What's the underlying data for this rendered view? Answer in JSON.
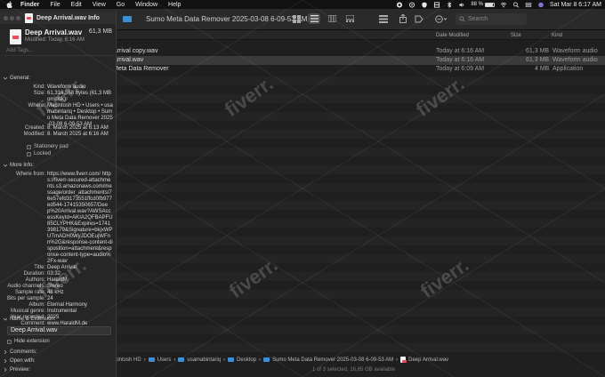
{
  "menubar": {
    "items": [
      "Finder",
      "File",
      "Edit",
      "View",
      "Go",
      "Window",
      "Help"
    ],
    "battery_percent": "88 %",
    "battery_level": 0.88,
    "datetime": "Sat Mar 8  6:17 AM"
  },
  "window": {
    "title": "Sumo Meta Data Remover 2025-03-08 6-09-53 AM",
    "search_placeholder": "Search"
  },
  "columns": {
    "date": "Date Modified",
    "size": "Size",
    "kind": "Kind"
  },
  "files": [
    {
      "name": "Arrival copy.wav",
      "date": "Today at 6:16 AM",
      "size": "61,3 MB",
      "kind": "Waveform audio"
    },
    {
      "name": "Arrival.wav",
      "date": "Today at 6:16 AM",
      "size": "61,3 MB",
      "kind": "Waveform audio"
    },
    {
      "name": "Meta Data Remover",
      "date": "Today at 6:09 AM",
      "size": "4 MB",
      "kind": "Application"
    }
  ],
  "path": [
    "Macintosh HD",
    "Users",
    "usamabintariq",
    "Desktop",
    "Sumo Meta Data Remover 2025-03-08 6-09-53 AM",
    "Deep Arrival.wav"
  ],
  "status": "1 of 3 selected, 16,85 GB available",
  "info": {
    "window_title": "Deep Arrival.wav Info",
    "file_name": "Deep Arrival.wav",
    "file_size": "61,3 MB",
    "modified_line": "Modified: Today, 6:16 AM",
    "tags_placeholder": "Add Tags...",
    "general_label": "General:",
    "general": [
      {
        "k": "Kind:",
        "v": "Waveform audio"
      },
      {
        "k": "Size:",
        "v": "61,318,558 bytes (61,3 MB on disk)"
      },
      {
        "k": "Where:",
        "v": "Macintosh HD • Users • usamabintariq • Desktop • Sumo Meta Data Remover 2025-03-08 6-09-53 AM"
      },
      {
        "k": "Created:",
        "v": "8. March 2025 at 6:13 AM"
      },
      {
        "k": "Modified:",
        "v": "8. March 2025 at 6:16 AM"
      }
    ],
    "stationery": "Stationery pad",
    "locked": "Locked",
    "more_info_label": "More Info:",
    "more_info": [
      {
        "k": "Where from:",
        "v": "https://www.fiverr.com/ https://fiverr-secured-attachments.s3.amazonaws.com/message/order_attachments/76e57efd3173551ffcd0fb977ed544-17415350657/Deep%20Arrival.wav?AWSAccessKeyId=AKIA2QFBAPFU85CLYPHK&Expires=1741398179&Signature=bkjxWPUTmADH0WyJDOEujWFnn%2G&response-content-disposition=attachment&response-content-type=audio%2Fx-wav"
      },
      {
        "k": "Title:",
        "v": "Deep Arrival"
      },
      {
        "k": "Duration:",
        "v": "03:32"
      },
      {
        "k": "Authors:",
        "v": "HaraldM"
      },
      {
        "k": "Audio channels:",
        "v": "Stereo"
      },
      {
        "k": "Sample rate:",
        "v": "48 kHz"
      },
      {
        "k": "Bits per sample:",
        "v": "24"
      },
      {
        "k": "Album:",
        "v": "Eternal Harmony"
      },
      {
        "k": "Musical genre:",
        "v": "Instrumental"
      },
      {
        "k": "Year recorded:",
        "v": "2025"
      },
      {
        "k": "Comment:",
        "v": "www.HaraldM.de"
      }
    ],
    "name_ext_label": "Name & Extension:",
    "name_value": "Deep Arrival.wav",
    "hide_ext": "Hide extension",
    "comments_label": "Comments:",
    "open_with_label": "Open with:",
    "preview_label": "Preview:"
  },
  "watermark": "fiverr."
}
